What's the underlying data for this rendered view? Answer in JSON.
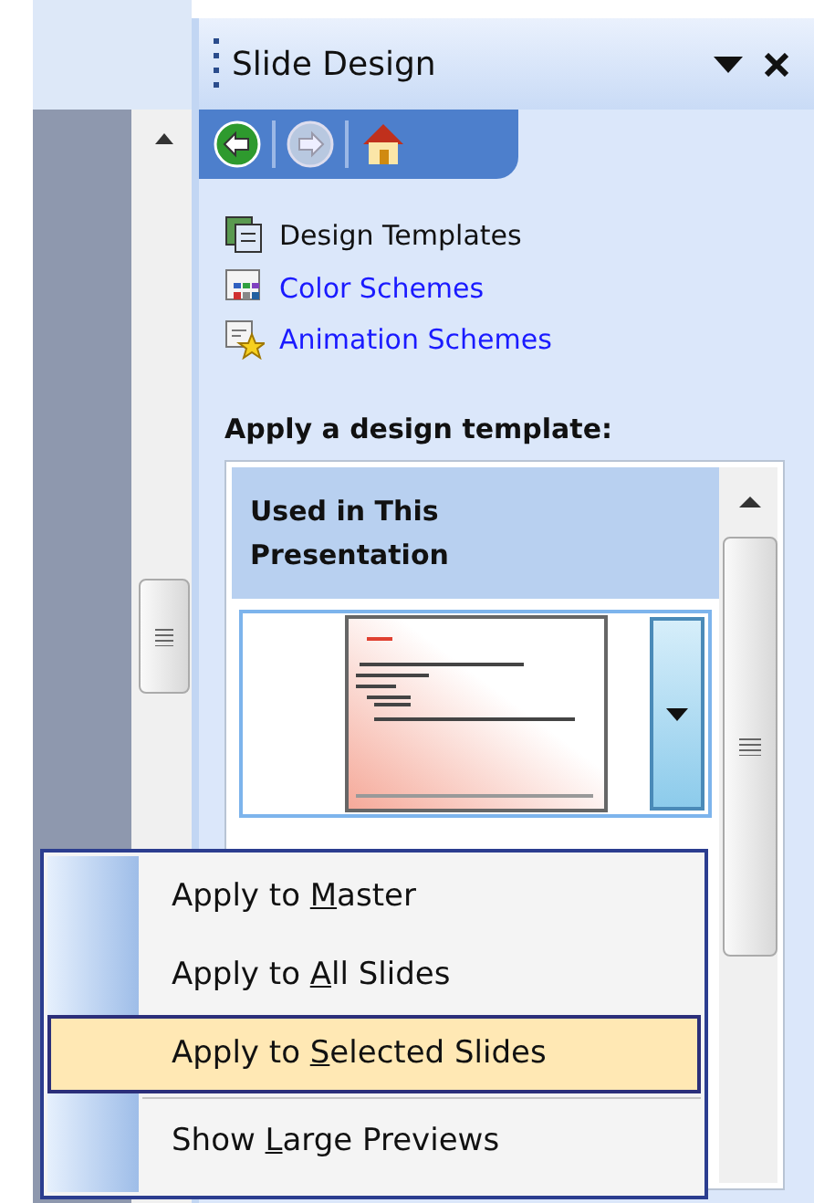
{
  "task_pane": {
    "title": "Slide Design",
    "nav_buttons": [
      {
        "kind": "back",
        "disabled": false
      },
      {
        "kind": "forward",
        "disabled": true
      },
      {
        "kind": "home",
        "disabled": false
      }
    ],
    "links": [
      {
        "kind": "templates",
        "label": "Design Templates",
        "selected": true
      },
      {
        "kind": "colors",
        "label": "Color Schemes",
        "selected": false
      },
      {
        "kind": "animation",
        "label": "Animation Schemes",
        "selected": false
      }
    ],
    "section_heading": "Apply a design template:",
    "gallery": {
      "group_heading": "Used in This Presentation"
    }
  },
  "context_menu": [
    {
      "before": "Apply to ",
      "mnemonic": "M",
      "after": "aster",
      "selected": false
    },
    {
      "before": "Apply to ",
      "mnemonic": "A",
      "after": "ll Slides",
      "selected": false
    },
    {
      "before": "Apply to ",
      "mnemonic": "S",
      "after": "elected Slides",
      "selected": true
    },
    {
      "before": "Show ",
      "mnemonic": "L",
      "after": "arge Previews",
      "selected": false,
      "separator_before": true
    }
  ]
}
